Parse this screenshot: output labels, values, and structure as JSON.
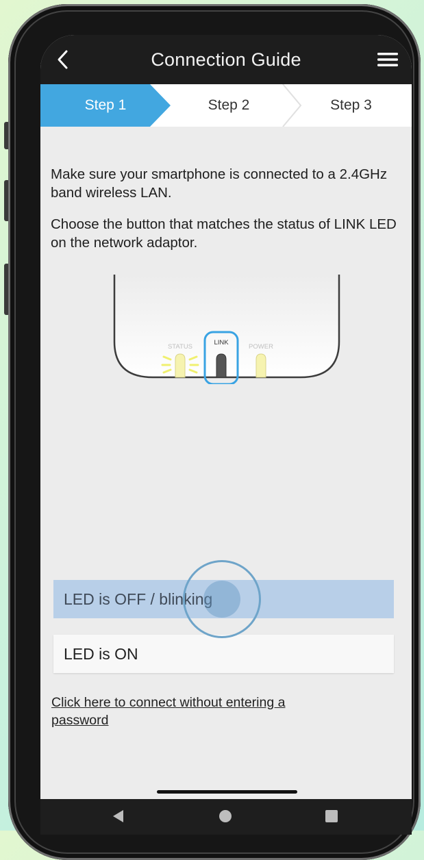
{
  "header": {
    "back_icon": "chevron-left-icon",
    "title": "Connection Guide",
    "menu_icon": "hamburger-menu-icon"
  },
  "steps": {
    "active_index": 0,
    "items": [
      {
        "label": "Step 1"
      },
      {
        "label": "Step 2"
      },
      {
        "label": "Step 3"
      }
    ]
  },
  "instructions": {
    "line1": "Make sure your smartphone is connected to a 2.4GHz band wireless LAN.",
    "line2": "Choose the button that matches the status of LINK LED on the network adaptor."
  },
  "device": {
    "leds": [
      {
        "label": "STATUS",
        "state": "blinking"
      },
      {
        "label": "LINK",
        "state": "off",
        "highlighted": true
      },
      {
        "label": "POWER",
        "state": "on"
      }
    ]
  },
  "options": [
    {
      "label": "LED is OFF / blinking",
      "pressed": true
    },
    {
      "label": "LED is ON",
      "pressed": false
    }
  ],
  "link_text": "Click here to connect without entering a password",
  "navbar": {
    "back_icon": "triangle-back-icon",
    "home_icon": "circle-home-icon",
    "recents_icon": "square-recents-icon"
  },
  "colors": {
    "accent": "#42a7e0",
    "header_bg": "#1d1d1d",
    "pressed_option": "#b8cfe8"
  }
}
